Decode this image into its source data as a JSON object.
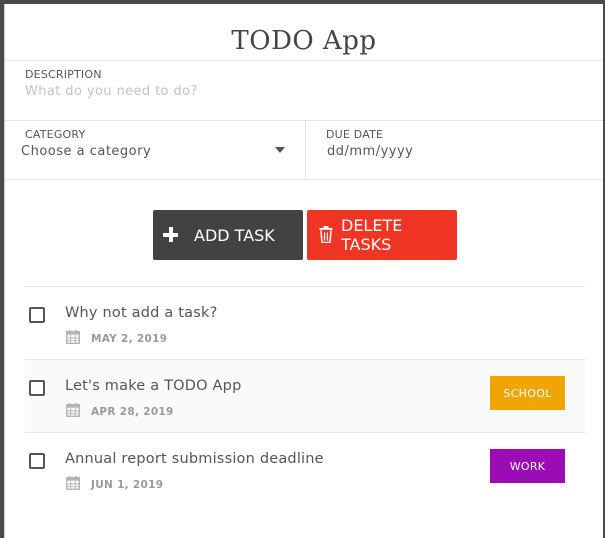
{
  "app": {
    "title": "TODO App"
  },
  "form": {
    "description": {
      "label": "DESCRIPTION",
      "placeholder": "What do you need to do?"
    },
    "category": {
      "label": "CATEGORY",
      "selected": "Choose a category"
    },
    "due_date": {
      "label": "DUE DATE",
      "value": "dd/mm/yyyy"
    }
  },
  "actions": {
    "add_label": "ADD TASK",
    "add_icon": "plus-icon",
    "delete_label": "DELETE TASKS",
    "delete_icon": "trash-icon",
    "add_color": "#424242",
    "delete_color": "#f13424"
  },
  "tasks": [
    {
      "text": "Why not add a task?",
      "date": "MAY 2, 2019",
      "tag": "",
      "tag_color": ""
    },
    {
      "text": "Let's make a TODO App",
      "date": "APR 28, 2019",
      "tag": "SCHOOL",
      "tag_color": "#f0a500"
    },
    {
      "text": "Annual report submission deadline",
      "date": "JUN 1, 2019",
      "tag": "WORK",
      "tag_color": "#9b0cb4"
    }
  ]
}
